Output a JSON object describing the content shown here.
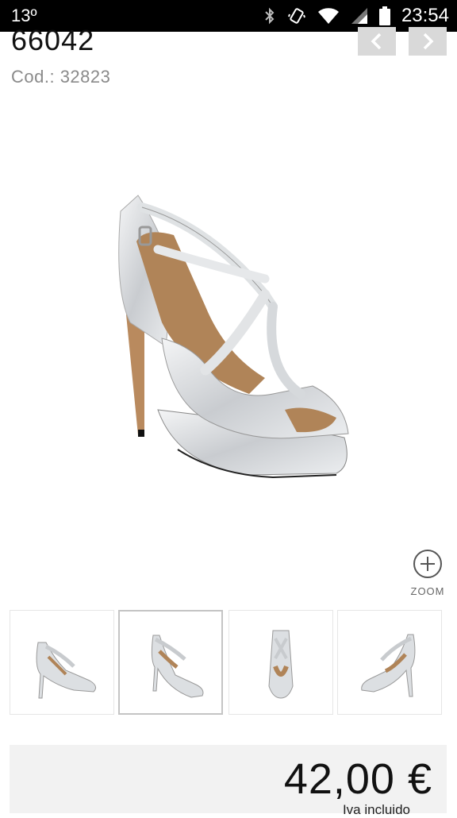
{
  "status_bar": {
    "temperature": "13º",
    "time": "23:54",
    "icons": [
      "bluetooth-icon",
      "vibrate-icon",
      "wifi-icon",
      "signal-icon",
      "battery-icon"
    ]
  },
  "product": {
    "name": "66042",
    "code": "Cod.: 32823"
  },
  "navigation": {
    "prev_icon": "chevron-left-icon",
    "next_icon": "chevron-right-icon"
  },
  "gallery": {
    "zoom_label": "ZOOM",
    "thumbnails": [
      {
        "view": "side",
        "selected": false
      },
      {
        "view": "three-quarter",
        "selected": true
      },
      {
        "view": "front",
        "selected": false
      },
      {
        "view": "back",
        "selected": false
      }
    ]
  },
  "pricing": {
    "price": "42,00 €",
    "vat_note": "Iva incluido"
  },
  "colors": {
    "status_bar_bg": "#000000",
    "nav_button_bg": "#d9d9d9",
    "price_box_bg": "#f2f2f2",
    "shoe_silver": "#d9dcdf",
    "shoe_lining": "#b08458"
  }
}
